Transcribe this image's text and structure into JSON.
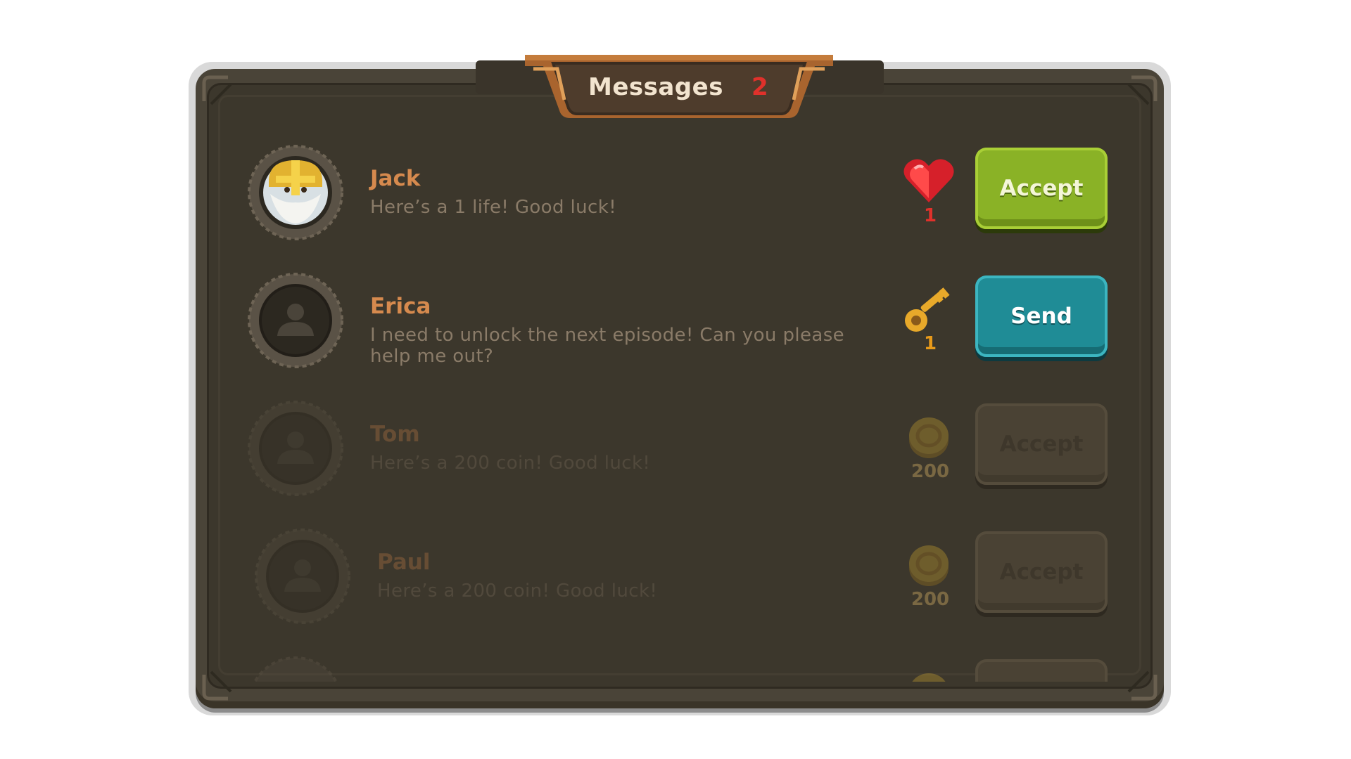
{
  "header": {
    "title": "Messages",
    "count": "2"
  },
  "messages": [
    {
      "name": "Jack",
      "text": "Here’s a 1 life! Good luck!",
      "reward_icon": "heart-icon",
      "reward_count": "1",
      "reward_color": "#e0312b",
      "button_label": "Accept",
      "button_type": "accept",
      "avatar": "knight-avatar"
    },
    {
      "name": "Erica",
      "text": "I need to unlock the next episode!  Can you please help me out?",
      "reward_icon": "key-icon",
      "reward_count": "1",
      "reward_color": "#e89a1a",
      "button_label": "Send",
      "button_type": "send",
      "avatar": "default-user-avatar"
    },
    {
      "name": "Tom",
      "text": "Here’s a 200 coin! Good luck!",
      "reward_icon": "coin-icon",
      "reward_count": "200",
      "reward_color": "#b89a5a",
      "button_label": "Accept",
      "button_type": "disabled",
      "avatar": "default-user-avatar"
    },
    {
      "name": "Paul",
      "text": "Here’s a 200 coin! Good luck!",
      "reward_icon": "coin-icon",
      "reward_count": "200",
      "reward_color": "#b89a5a",
      "button_label": "Accept",
      "button_type": "disabled",
      "avatar": "default-user-avatar"
    }
  ],
  "colors": {
    "panel": "#4a4438",
    "panel_inner": "#3c372c",
    "name": "#d68a4e",
    "message": "#8a7b68",
    "accept": "#8ab226",
    "send": "#1f8c96"
  }
}
